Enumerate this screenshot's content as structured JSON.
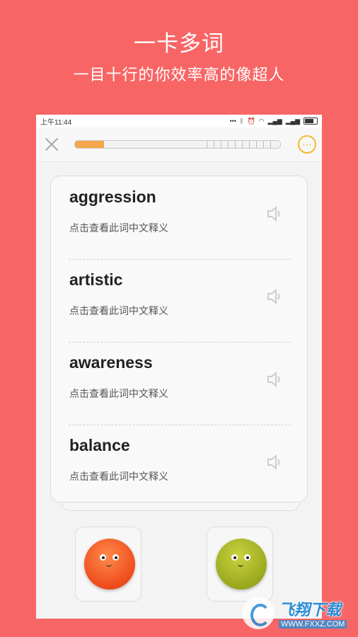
{
  "promo": {
    "title": "一卡多词",
    "subtitle": "一目十行的你效率高的像超人"
  },
  "status_bar": {
    "time": "上午11:44",
    "icons": [
      "dots-icon",
      "bluetooth-icon",
      "alarm-icon",
      "wifi-icon",
      "signal-icon",
      "signal-icon",
      "battery-icon"
    ]
  },
  "progress": {
    "fraction": 0.14,
    "accent": "#f5a64a"
  },
  "words": [
    {
      "word": "aggression",
      "hint": "点击查看此词中文释义"
    },
    {
      "word": "artistic",
      "hint": "点击查看此词中文释义"
    },
    {
      "word": "awareness",
      "hint": "点击查看此词中文释义"
    },
    {
      "word": "balance",
      "hint": "点击查看此词中文释义"
    }
  ],
  "buttons": {
    "unknown_color": "#ee4c1c",
    "known_color": "#9aa81d"
  },
  "watermark": {
    "name": "飞翔下载",
    "url": "WWW.FXXZ.COM"
  }
}
